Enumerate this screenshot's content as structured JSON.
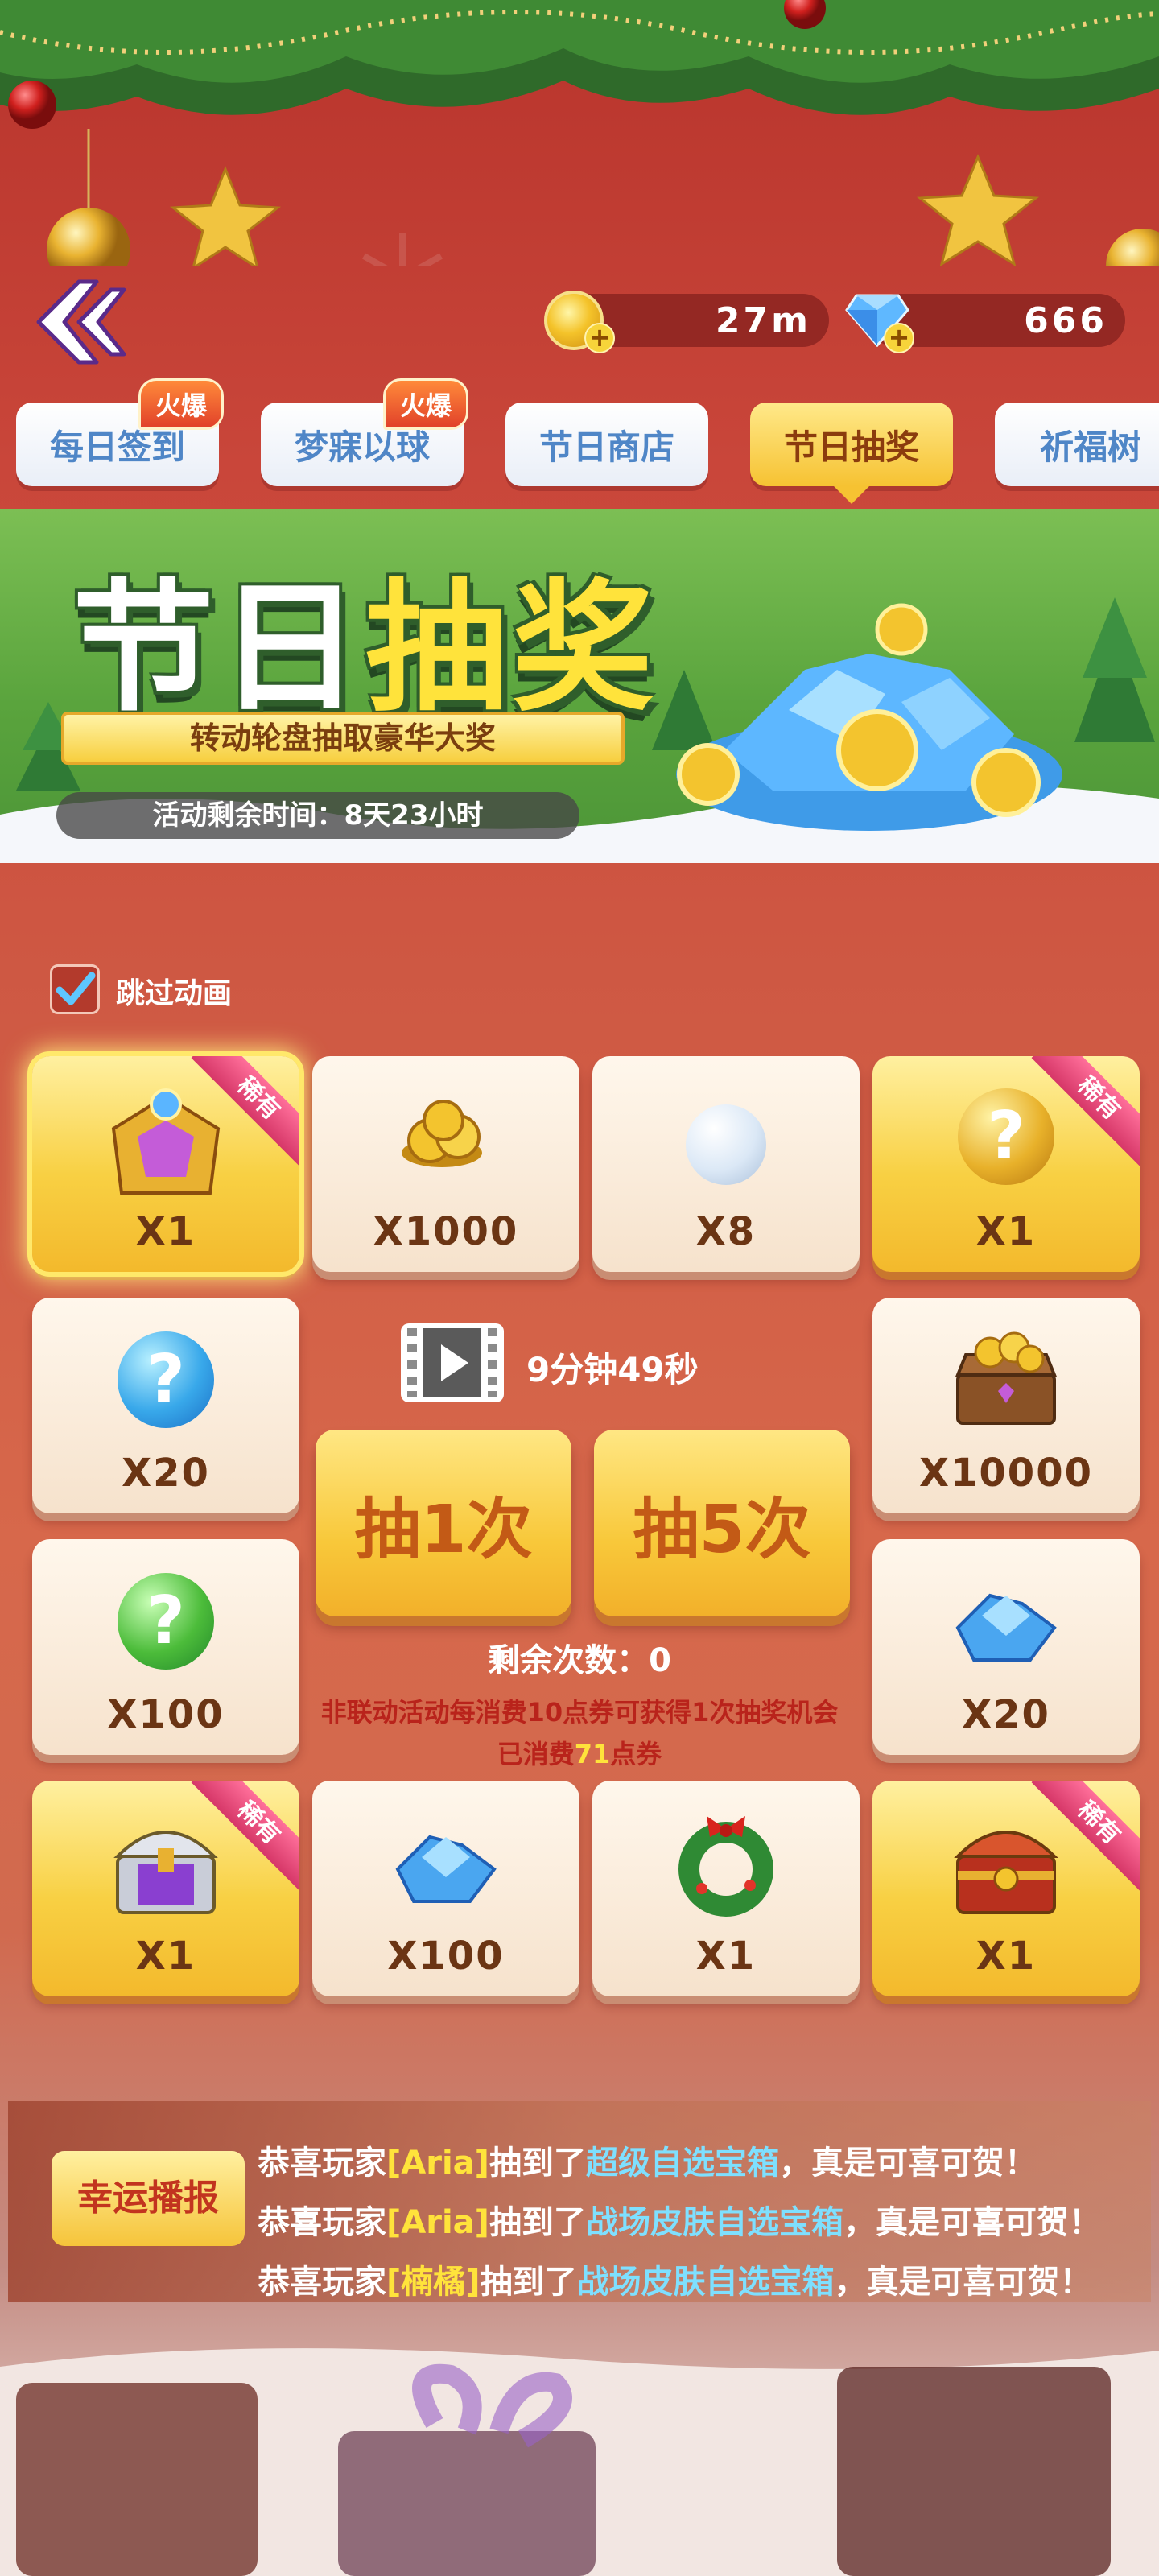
{
  "currencies": [
    {
      "icon": "gold-coin-icon",
      "value": "27m"
    },
    {
      "icon": "diamond-icon",
      "value": "666"
    }
  ],
  "tabs": [
    {
      "label": "每日签到",
      "badge": "火爆"
    },
    {
      "label": "梦寐以球",
      "badge": "火爆"
    },
    {
      "label": "节日商店",
      "badge": ""
    },
    {
      "label": "节日抽奖",
      "badge": "",
      "active": true
    },
    {
      "label": "祈福树",
      "badge": ""
    }
  ],
  "banner": {
    "title_part1": "节日",
    "title_part2": "抽奖",
    "subtitle": "转动轮盘抽取豪华大奖",
    "timer": "活动剩余时间：8天23小时"
  },
  "skip_animation": {
    "label": "跳过动画",
    "checked": true
  },
  "rare_label": "稀有",
  "prizes": [
    {
      "icon": "golden-armor-chest-icon",
      "qty": "X1",
      "rare": true,
      "selected": true
    },
    {
      "icon": "gold-coins-icon",
      "qty": "X1000",
      "rare": false
    },
    {
      "icon": "snowball-icon",
      "qty": "X8",
      "rare": false
    },
    {
      "icon": "gold-mystery-orb-icon",
      "qty": "X1",
      "rare": true
    },
    {
      "icon": "blue-mystery-orb-icon",
      "qty": "X20",
      "rare": false
    },
    {
      "icon": "treasure-chest-coins-icon",
      "qty": "X10000",
      "rare": false
    },
    {
      "icon": "green-mystery-orb-icon",
      "qty": "X100",
      "rare": false
    },
    {
      "icon": "diamond-pile-icon",
      "qty": "X20",
      "rare": false
    },
    {
      "icon": "purple-chest-icon",
      "qty": "X1",
      "rare": true
    },
    {
      "icon": "diamond-pile-icon",
      "qty": "X100",
      "rare": false
    },
    {
      "icon": "christmas-wreath-icon",
      "qty": "X1",
      "rare": false
    },
    {
      "icon": "red-gold-chest-icon",
      "qty": "X1",
      "rare": true
    }
  ],
  "video": {
    "timer": "9分钟49秒"
  },
  "draw_buttons": {
    "once": "抽1次",
    "five": "抽5次"
  },
  "remaining": "剩余次数：0",
  "rule": "非联动活动每消费10点券可获得1次抽奖机会",
  "spent": {
    "prefix": "已消费",
    "amount": "71",
    "suffix": "点券"
  },
  "broadcast": {
    "badge": "幸运播报",
    "lines": [
      {
        "pre": "恭喜玩家",
        "name": "[Aria]",
        "mid": "抽到了",
        "item": "超级自选宝箱",
        "post": "，真是可喜可贺！"
      },
      {
        "pre": "恭喜玩家",
        "name": "[Aria]",
        "mid": "抽到了",
        "item": "战场皮肤自选宝箱",
        "post": "，真是可喜可贺！"
      },
      {
        "pre": "恭喜玩家",
        "name": "[楠橘]",
        "mid": "抽到了",
        "item": "战场皮肤自选宝箱",
        "post": "，真是可喜可贺！"
      }
    ]
  },
  "colors": {
    "accent_gold": "#f6c232",
    "rare_pink": "#d63768",
    "tab_text_blue": "#4f86c7"
  }
}
